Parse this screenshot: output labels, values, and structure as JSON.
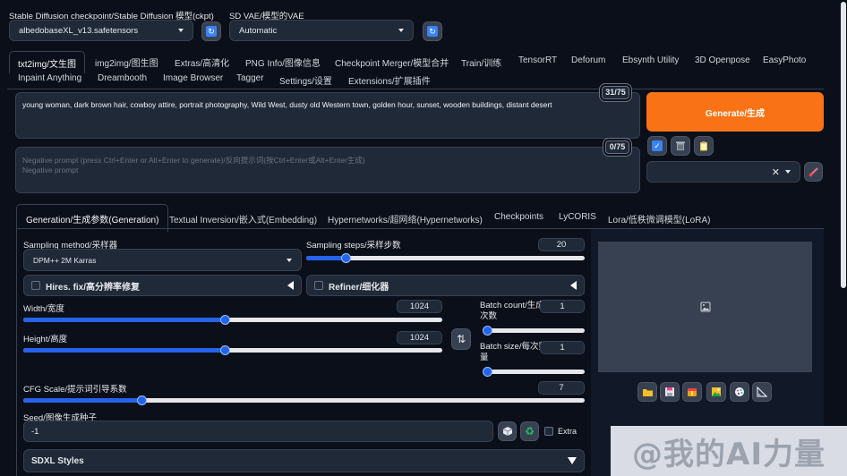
{
  "header": {
    "checkpoint_label": "Stable Diffusion checkpoint/Stable Diffusion 模型(ckpt)",
    "checkpoint_value": "albedobaseXL_v13.safetensors",
    "vae_label": "SD VAE/模型的VAE",
    "vae_value": "Automatic"
  },
  "tabs_row1": [
    "txt2img/文生图",
    "img2img/图生图",
    "Extras/高清化",
    "PNG Info/图像信息",
    "Checkpoint Merger/模型合并",
    "Train/训练",
    "TensorRT",
    "Deforum",
    "Ebsynth Utility",
    "3D Openpose",
    "EasyPhoto"
  ],
  "tabs_row2": [
    "Inpaint Anything",
    "Dreambooth",
    "Image Browser",
    "Tagger",
    "Settings/设置",
    "Extensions/扩展插件"
  ],
  "prompt": {
    "text": "young woman, dark brown hair, cowboy attire, portrait photography, Wild West, dusty old Western town, golden hour, sunset, wooden buildings, distant desert",
    "counter": "31/75"
  },
  "negative_prompt": {
    "placeholder_line1": "Negative prompt (press Ctrl+Enter or Alt+Enter to generate)/反向提示词(按Ctrl+Enter或Alt+Enter生成)",
    "placeholder_line2": "Negative prompt",
    "counter": "0/75"
  },
  "generate_label": "Generate/生成",
  "subtabs": [
    "Generation/生成参数(Generation)",
    "Textual Inversion/嵌入式(Embedding)",
    "Hypernetworks/超网络(Hypernetworks)",
    "Checkpoints",
    "LyCORIS",
    "Lora/低秩微调模型(LoRA)"
  ],
  "generation": {
    "sampling_method_label": "Sampling method/采样器",
    "sampling_method_value": "DPM++ 2M Karras",
    "sampling_steps_label": "Sampling steps/采样步数",
    "sampling_steps_value": "20",
    "sampling_steps_fraction": 0.14,
    "hires_label": "Hires. fix/高分辨率修复",
    "refiner_label": "Refiner/细化器",
    "width_label": "Width/宽度",
    "width_value": "1024",
    "width_fraction": 0.48,
    "height_label": "Height/高度",
    "height_value": "1024",
    "height_fraction": 0.48,
    "batch_count_label_line1": "Batch count/生成",
    "batch_count_label_line2": "次数",
    "batch_count_value": "1",
    "batch_count_fraction": 0.0,
    "batch_size_label_line1": "Batch size/每次数",
    "batch_size_label_line2": "量",
    "batch_size_value": "1",
    "batch_size_fraction": 0.0,
    "cfg_label": "CFG Scale/提示词引导系数",
    "cfg_value": "7",
    "cfg_fraction": 0.21,
    "seed_label": "Seed/图像生成种子",
    "seed_value": "-1",
    "extra_label": "Extra",
    "sdxl_styles_label": "SDXL Styles"
  },
  "watermark": "@我的AI力量",
  "colors": {
    "background": "#0b0f19",
    "accent_orange": "#f97316",
    "slider_blue": "#2563eb"
  },
  "icons": [
    "refresh-icon",
    "paste-icon",
    "trash-icon",
    "clipboard-icon",
    "brush-icon",
    "image-placeholder-icon",
    "folder-icon",
    "save-icon",
    "zip-icon",
    "send-to-img2img-icon",
    "send-to-inpaint-icon",
    "send-to-extras-icon",
    "swap-icon",
    "dice-icon",
    "recycle-icon"
  ]
}
